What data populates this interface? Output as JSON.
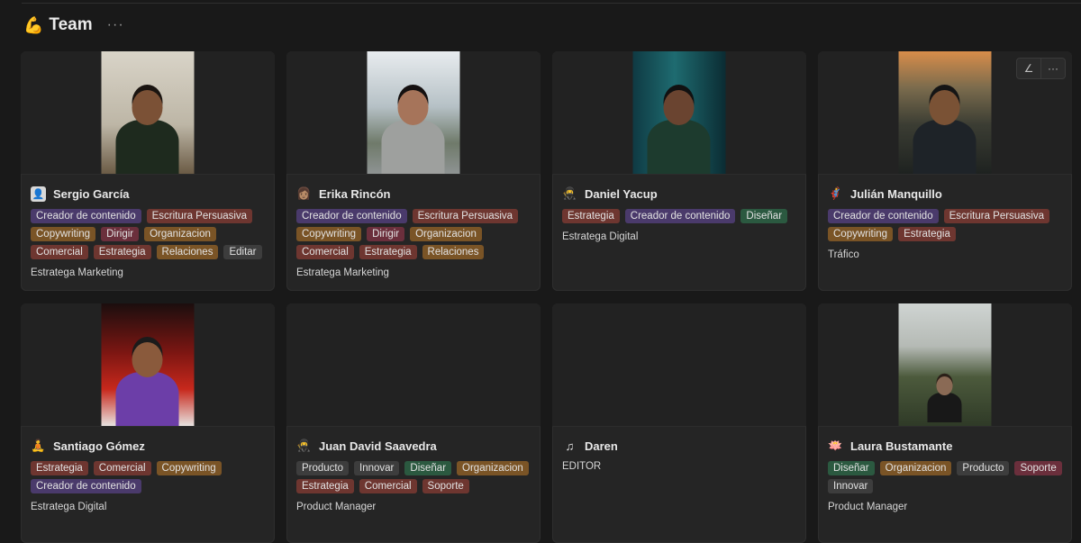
{
  "header": {
    "emoji": "💪",
    "title": "Team",
    "more": "···"
  },
  "colors": {
    "purple": "#4a3a6b",
    "red": "#6e3630",
    "brown": "#7a5426",
    "gray": "#3d3d3d",
    "green": "#2b5940",
    "pink": "#6b2f3c"
  },
  "card_actions": {
    "edit_icon": "pencil-icon",
    "more_icon": "more-icon"
  },
  "members": [
    {
      "name": "Sergio García",
      "avatar_icon": "photo-avatar",
      "avatar_glyph": "👤",
      "tags": [
        {
          "label": "Creador de contenido",
          "color": "purple"
        },
        {
          "label": "Escritura Persuasiva",
          "color": "red"
        },
        {
          "label": "Copywriting",
          "color": "brown"
        },
        {
          "label": "Dirigir",
          "color": "pink"
        },
        {
          "label": "Organizacion",
          "color": "brown"
        },
        {
          "label": "Comercial",
          "color": "red"
        },
        {
          "label": "Estrategia",
          "color": "red"
        },
        {
          "label": "Relaciones",
          "color": "brown"
        },
        {
          "label": "Editar",
          "color": "gray"
        }
      ],
      "role": "Estratega Marketing",
      "has_photo": true
    },
    {
      "name": "Erika Rincón",
      "avatar_icon": "woman-emoji",
      "avatar_glyph": "👩🏽",
      "tags": [
        {
          "label": "Creador de contenido",
          "color": "purple"
        },
        {
          "label": "Escritura Persuasiva",
          "color": "red"
        },
        {
          "label": "Copywriting",
          "color": "brown"
        },
        {
          "label": "Dirigir",
          "color": "pink"
        },
        {
          "label": "Organizacion",
          "color": "brown"
        },
        {
          "label": "Comercial",
          "color": "red"
        },
        {
          "label": "Estrategia",
          "color": "red"
        },
        {
          "label": "Relaciones",
          "color": "brown"
        }
      ],
      "role": "Estratega Marketing",
      "has_photo": true
    },
    {
      "name": "Daniel Yacup",
      "avatar_icon": "ninja-emoji",
      "avatar_glyph": "🥷",
      "tags": [
        {
          "label": "Estrategia",
          "color": "red"
        },
        {
          "label": "Creador de contenido",
          "color": "purple"
        },
        {
          "label": "Diseñar",
          "color": "green"
        }
      ],
      "role": "Estratega Digital",
      "has_photo": true
    },
    {
      "name": "Julián Manquillo",
      "avatar_icon": "superhero-emoji",
      "avatar_glyph": "🦸",
      "tags": [
        {
          "label": "Creador de contenido",
          "color": "purple"
        },
        {
          "label": "Escritura Persuasiva",
          "color": "red"
        },
        {
          "label": "Copywriting",
          "color": "brown"
        },
        {
          "label": "Estrategia",
          "color": "red"
        }
      ],
      "role": "Tráfico",
      "has_photo": true
    },
    {
      "name": "Santiago Gómez",
      "avatar_icon": "meditation-emoji",
      "avatar_glyph": "🧘",
      "tags": [
        {
          "label": "Estrategia",
          "color": "red"
        },
        {
          "label": "Comercial",
          "color": "red"
        },
        {
          "label": "Copywriting",
          "color": "brown"
        },
        {
          "label": "Creador de contenido",
          "color": "purple"
        }
      ],
      "role": "Estratega Digital",
      "has_photo": true
    },
    {
      "name": "Juan David Saavedra",
      "avatar_icon": "ninja-emoji",
      "avatar_glyph": "🥷",
      "tags": [
        {
          "label": "Producto",
          "color": "gray"
        },
        {
          "label": "Innovar",
          "color": "gray"
        },
        {
          "label": "Diseñar",
          "color": "green"
        },
        {
          "label": "Organizacion",
          "color": "brown"
        },
        {
          "label": "Estrategia",
          "color": "red"
        },
        {
          "label": "Comercial",
          "color": "red"
        },
        {
          "label": "Soporte",
          "color": "red"
        }
      ],
      "role": "Product Manager",
      "has_photo": false
    },
    {
      "name": "Daren",
      "avatar_icon": "music-note-icon",
      "avatar_glyph": "♫",
      "tags": [],
      "role": "EDITOR",
      "has_photo": false
    },
    {
      "name": "Laura Bustamante",
      "avatar_icon": "lotus-emoji",
      "avatar_glyph": "🪷",
      "tags": [
        {
          "label": "Diseñar",
          "color": "green"
        },
        {
          "label": "Organizacion",
          "color": "brown"
        },
        {
          "label": "Producto",
          "color": "gray"
        },
        {
          "label": "Soporte",
          "color": "pink"
        },
        {
          "label": "Innovar",
          "color": "gray"
        }
      ],
      "role": "Product Manager",
      "has_photo": true
    }
  ]
}
